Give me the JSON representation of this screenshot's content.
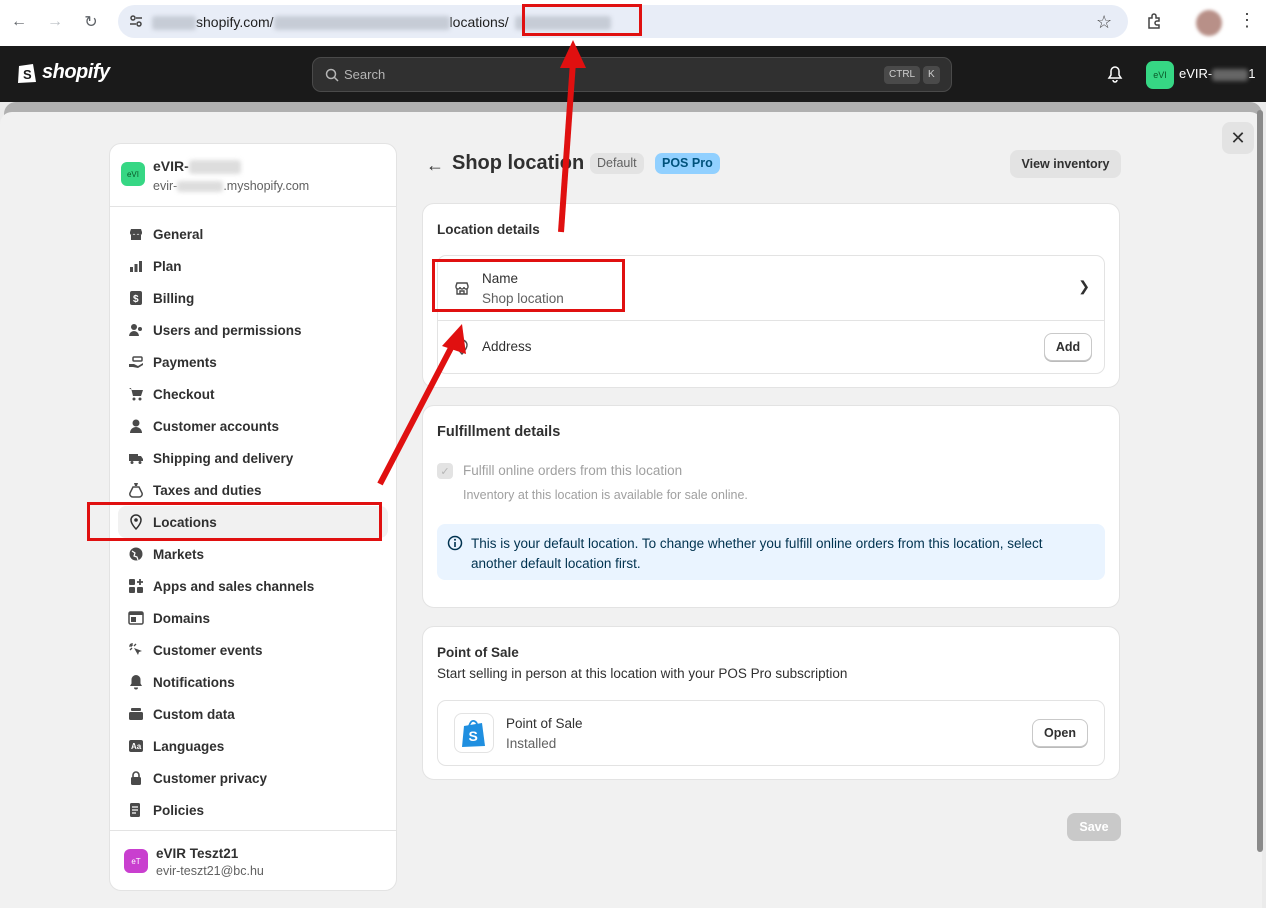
{
  "browser": {
    "url_domain": "shopify.com/",
    "url_path": "locations/"
  },
  "topbar": {
    "logo_text": "shopify",
    "search_placeholder": "Search",
    "shortcut_ctrl": "CTRL",
    "shortcut_k": "K",
    "store_initials": "eVI",
    "store_name": "eVIR-",
    "store_suffix": "1"
  },
  "sidebar": {
    "store_initials": "eVI",
    "store_name": "eVIR-",
    "store_url_prefix": "evir-",
    "store_url_suffix": ".myshopify.com",
    "items": [
      {
        "label": "General",
        "icon": "store-icon"
      },
      {
        "label": "Plan",
        "icon": "chart-icon"
      },
      {
        "label": "Billing",
        "icon": "dollar-icon"
      },
      {
        "label": "Users and permissions",
        "icon": "users-icon"
      },
      {
        "label": "Payments",
        "icon": "payment-hand-icon"
      },
      {
        "label": "Checkout",
        "icon": "cart-icon"
      },
      {
        "label": "Customer accounts",
        "icon": "person-icon"
      },
      {
        "label": "Shipping and delivery",
        "icon": "truck-icon"
      },
      {
        "label": "Taxes and duties",
        "icon": "tax-bag-icon"
      },
      {
        "label": "Locations",
        "icon": "location-pin-icon",
        "active": true
      },
      {
        "label": "Markets",
        "icon": "globe-icon"
      },
      {
        "label": "Apps and sales channels",
        "icon": "apps-icon"
      },
      {
        "label": "Domains",
        "icon": "domain-icon"
      },
      {
        "label": "Customer events",
        "icon": "cursor-click-icon"
      },
      {
        "label": "Notifications",
        "icon": "bell-icon"
      },
      {
        "label": "Custom data",
        "icon": "database-icon"
      },
      {
        "label": "Languages",
        "icon": "language-icon"
      },
      {
        "label": "Customer privacy",
        "icon": "lock-icon"
      },
      {
        "label": "Policies",
        "icon": "policy-icon"
      }
    ],
    "user_initials": "eT",
    "user_name": "eVIR Teszt21",
    "user_email": "evir-teszt21@bc.hu"
  },
  "page": {
    "title": "Shop location",
    "badge_default": "Default",
    "badge_pos": "POS Pro",
    "view_inventory": "View inventory",
    "save": "Save"
  },
  "location_details": {
    "title": "Location details",
    "name_label": "Name",
    "name_value": "Shop location",
    "address_label": "Address",
    "add_button": "Add"
  },
  "fulfillment": {
    "title": "Fulfillment details",
    "checkbox_label": "Fulfill online orders from this location",
    "checkbox_help": "Inventory at this location is available for sale online.",
    "banner": "This is your default location. To change whether you fulfill online orders from this location, select another default location first."
  },
  "pos": {
    "title": "Point of Sale",
    "subtitle": "Start selling in person at this location with your POS Pro subscription",
    "app_name": "Point of Sale",
    "app_status": "Installed",
    "open_button": "Open"
  },
  "colors": {
    "annotation_red": "#e01010",
    "pos_badge": "#91d0ff",
    "store_avatar": "#36d784",
    "user_avatar": "#c93fcf"
  }
}
